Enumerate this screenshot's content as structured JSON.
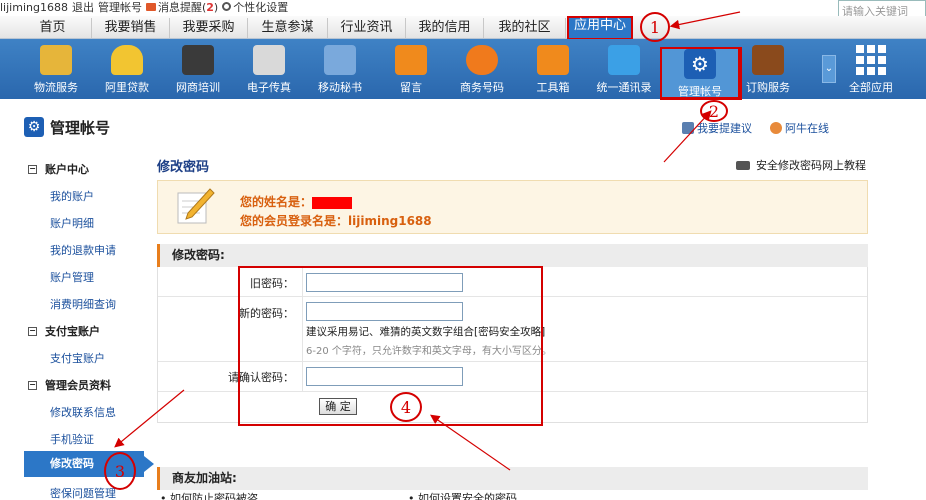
{
  "topbar": {
    "user": "lijiming1688",
    "logout": "退出",
    "manage_account": "管理帐号",
    "message_alert": "消息提醒(",
    "message_count": "2",
    "message_close": ")",
    "personalize": "个性化设置",
    "search_placeholder": "请输入关键词"
  },
  "nav_tabs": [
    {
      "label": "首页"
    },
    {
      "label": "我要销售"
    },
    {
      "label": "我要采购"
    },
    {
      "label": "生意参谋"
    },
    {
      "label": "行业资讯"
    },
    {
      "label": "我的信用"
    },
    {
      "label": "我的社区"
    },
    {
      "label": "应用中心"
    }
  ],
  "tools": [
    {
      "label": "物流服务",
      "icon": "truck-icon",
      "color": "#e6b53a"
    },
    {
      "label": "阿里贷款",
      "icon": "gold-ingot-icon",
      "color": "#f2c531"
    },
    {
      "label": "网商培训",
      "icon": "graduation-cap-icon",
      "color": "#444444"
    },
    {
      "label": "电子传真",
      "icon": "fax-icon",
      "color": "#dddddd"
    },
    {
      "label": "移动秘书",
      "icon": "mobile-secretary-icon",
      "color": "#7aa9dc"
    },
    {
      "label": "留言",
      "icon": "message-icon",
      "color": "#f08a1c"
    },
    {
      "label": "商务号码",
      "icon": "phone-icon",
      "color": "#f07a1c"
    },
    {
      "label": "工具箱",
      "icon": "wrench-icon",
      "color": "#f08a1c"
    },
    {
      "label": "统一通讯录",
      "icon": "contacts-icon",
      "color": "#3ba0e6"
    },
    {
      "label": "管理帐号",
      "icon": "gear-icon",
      "color": "#1d5fb4"
    },
    {
      "label": "订购服务",
      "icon": "order-book-icon",
      "color": "#8a4a1c"
    },
    {
      "label": "全部应用",
      "icon": "grid-icon",
      "color": "#ffffff"
    }
  ],
  "page": {
    "title": "管理帐号",
    "suggest_link": "我要提建议",
    "aliwangwang": "阿牛在线"
  },
  "sidebar": {
    "sections": [
      {
        "label": "账户中心",
        "items": [
          "我的账户",
          "账户明细",
          "我的退款申请",
          "账户管理",
          "消费明细查询"
        ]
      },
      {
        "label": "支付宝账户",
        "items": [
          "支付宝账户"
        ]
      },
      {
        "label": "管理会员资料",
        "items": [
          "修改联系信息",
          "手机验证",
          "修改密码",
          "密保问题管理"
        ]
      }
    ],
    "expand_symbol": "−"
  },
  "main": {
    "title": "修改密码",
    "tutorial_link": "安全修改密码网上教程",
    "name_label": "您的姓名是：",
    "login_label": "您的会员登录名是：",
    "login_value": "lijiming1688",
    "form_section": "修改密码:",
    "old_pw_label": "旧密码：",
    "new_pw_label": "新的密码：",
    "hint_main": "建议采用易记、难猜的英文数字组合[密码安全攻略]",
    "hint_rule": "6-20 个字符，只允许数字和英文字母，有大小写区分。",
    "confirm_label": "请确认密码：",
    "ok_button": "确 定",
    "old_pw_value": "",
    "new_pw_value": "",
    "confirm_value": ""
  },
  "lower_section": {
    "title": "商友加油站:",
    "link1": "• 如何防止密码被盗",
    "link2": "• 如何设置安全的密码"
  },
  "annotations": {
    "n1": "1",
    "n2": "2",
    "n3": "3",
    "n4": "4"
  }
}
